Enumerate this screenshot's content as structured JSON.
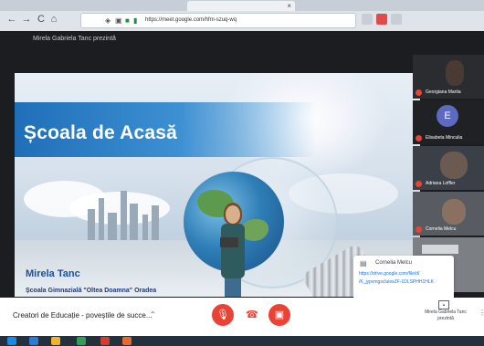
{
  "browser": {
    "tab_close": "×",
    "url": "https://meet.google.com/hfm-szuq-wq",
    "nav_back": "←",
    "nav_forward": "→",
    "nav_reload": "C",
    "nav_home": "⌂"
  },
  "meet": {
    "presenter_label": "Mirela Gabriela Tanc prezintă",
    "meeting_title": "Creatori de Educație - poveștile de succe...",
    "present_label": "Mirela Gabriela Tanc prezintă"
  },
  "slide": {
    "title": "Școala de Acasă",
    "name": "Mirela Tanc",
    "school": "Școala Gimnazială \"Oltea Doamna\" Oradea"
  },
  "chat": {
    "sender": "Cornelia Melcu",
    "message_line1": "https://drive.google.com/file/d/",
    "message_line2": "/K_jypvmgscluiexZF-1DLSPHH1HLK"
  },
  "participants": [
    {
      "name": "Georgiana Marita"
    },
    {
      "name": "Elisabeta Minculia",
      "avatar_letter": "E"
    },
    {
      "name": "Adriana Loffler"
    },
    {
      "name": "Cornelia Melcu"
    }
  ],
  "colors": {
    "accent": "#1a73e8",
    "danger": "#ea4335",
    "banner": "#1f6fb8"
  }
}
